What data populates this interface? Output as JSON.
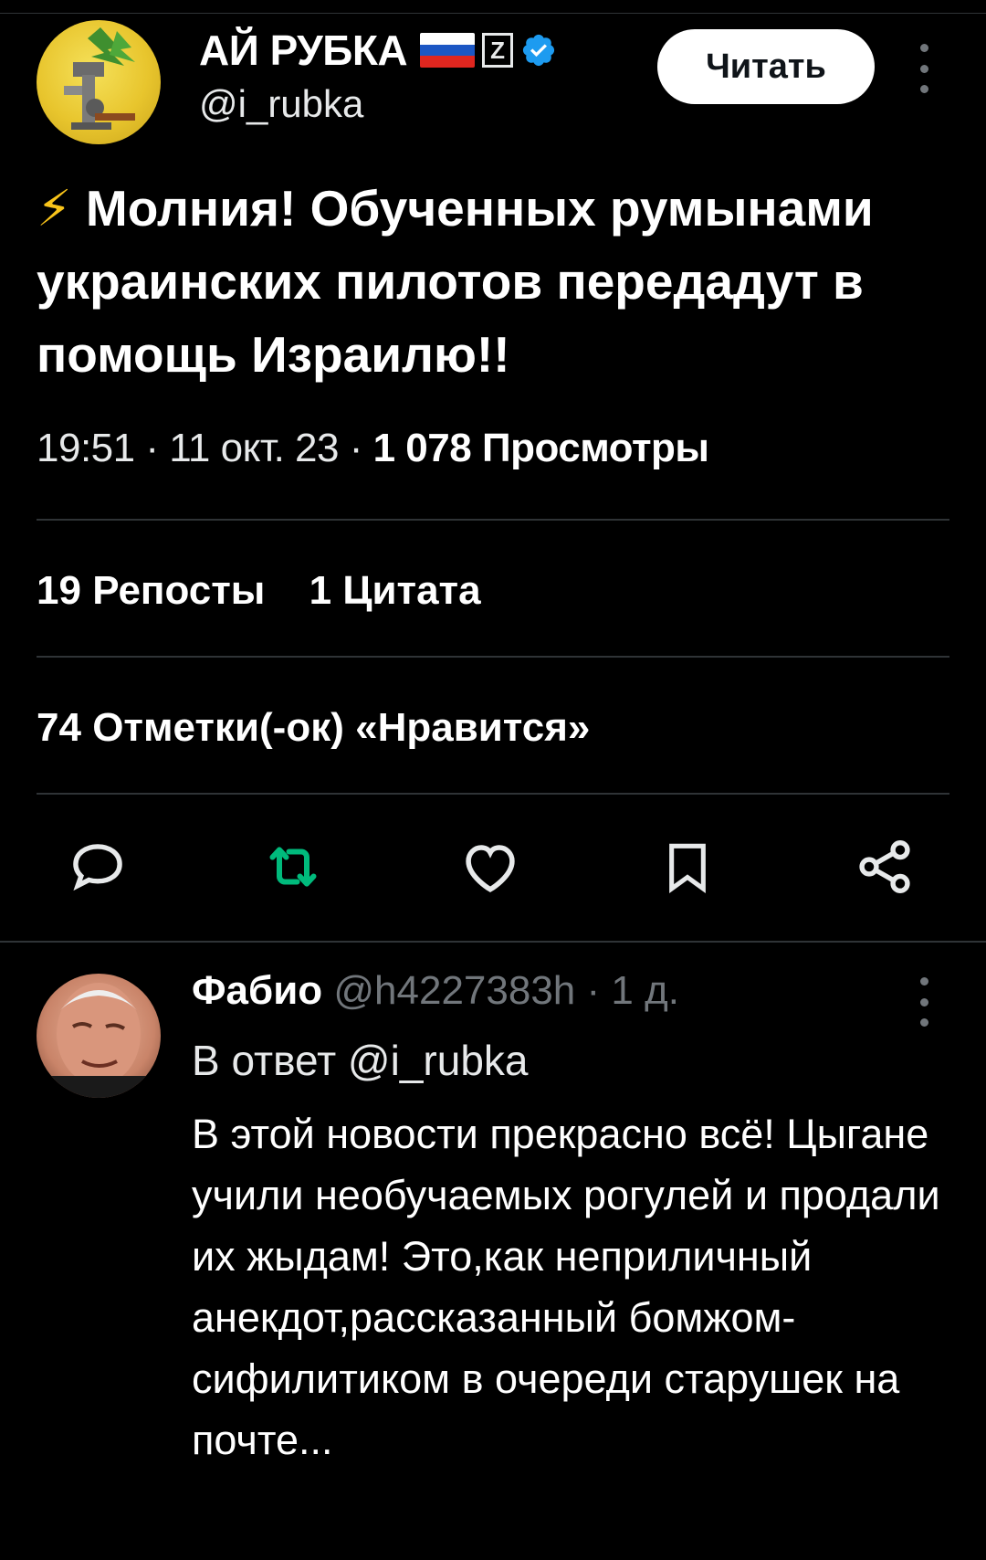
{
  "tweet": {
    "author": {
      "display_name": "АЙ РУБКА",
      "z_badge": "Z",
      "handle": "@i_rubka",
      "verified": true
    },
    "follow_label": "Читать",
    "bolt": "⚡",
    "text": "Молния! Обученных румынами украинских пилотов передадут в помощь Израилю!!",
    "time": "19:51 · 11 окт. 23 · ",
    "views_count": "1 078",
    "views_label": "Просмотры",
    "reposts_count": "19",
    "reposts_label": "Репосты",
    "quotes_count": "1",
    "quotes_label": "Цитата",
    "likes_count": "74",
    "likes_label": "Отметки(-ок) «Нравится»"
  },
  "actions": {
    "reply_icon": "reply-icon",
    "retweet_icon": "retweet-icon",
    "like_icon": "heart-icon",
    "bookmark_icon": "bookmark-icon",
    "share_icon": "share-icon"
  },
  "reply": {
    "name": "Фабио",
    "handle_time": " @h4227383h · 1 д.",
    "reply_to": "В ответ @i_rubka",
    "text": "В этой новости прекрасно всё! Цыгане учили необучаемых рогулей и продали их жыдам! Это,как неприличный анекдот,рассказанный бомжом-сифилитиком в очереди старушек на почте..."
  },
  "colors": {
    "background": "#000000",
    "divider": "#2f3336",
    "verified": "#1d9bf0",
    "retweet_active": "#00ba7c",
    "muted": "#71767b"
  }
}
